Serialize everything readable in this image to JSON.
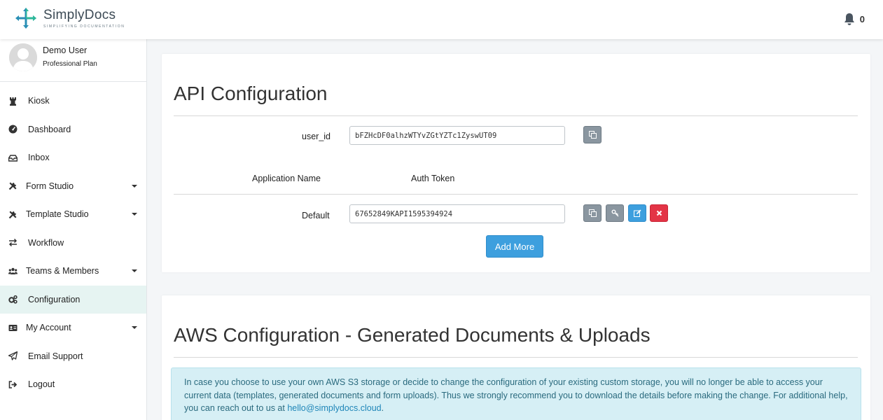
{
  "header": {
    "brand_name": "SimplyDocs",
    "brand_tagline": "SIMPLIFYING DOCUMENTATION",
    "notification_count": "0",
    "logo_colors": [
      "#2eb89a",
      "#2a8fb5"
    ]
  },
  "sidebar": {
    "user_name": "Demo User",
    "user_plan": "Professional Plan",
    "items": [
      {
        "label": "Kiosk",
        "icon": "chess-rook-icon"
      },
      {
        "label": "Dashboard",
        "icon": "tachometer-icon"
      },
      {
        "label": "Inbox",
        "icon": "inbox-icon"
      },
      {
        "label": "Form Studio",
        "icon": "tools-icon",
        "has_caret": true
      },
      {
        "label": "Template Studio",
        "icon": "tools-icon",
        "has_caret": true
      },
      {
        "label": "Workflow",
        "icon": "exchange-icon"
      },
      {
        "label": "Teams & Members",
        "icon": "users-icon",
        "has_caret": true
      },
      {
        "label": "Configuration",
        "icon": "cogs-icon",
        "active": true
      },
      {
        "label": "My Account",
        "icon": "id-card-icon",
        "has_caret": true
      },
      {
        "label": "Email Support",
        "icon": "paper-plane-icon"
      },
      {
        "label": "Logout",
        "icon": "sign-out-icon"
      }
    ],
    "active_color": "#e6f4f2"
  },
  "api_config": {
    "title": "API Configuration",
    "user_id_label": "user_id",
    "user_id_value": "bFZHcDF0alhzWTYvZGtYZTc1ZyswUT09",
    "col_app_name": "Application Name",
    "col_auth_token": "Auth Token",
    "rows": [
      {
        "app_name": "Default",
        "token": "67652849KAPI1595394924"
      }
    ],
    "add_more_label": "Add More"
  },
  "aws_config": {
    "title": "AWS Configuration - Generated Documents & Uploads",
    "notice_text": "In case you choose to use your own AWS S3 storage or decide to change the configuration of your existing custom storage, you will no longer be able to access your current data (templates, generated documents and form uploads). Thus we strongly recommend you to download the details before making the change. For additional help, you can reach out to us at ",
    "notice_email": "hello@simplydocs.cloud",
    "notice_end": "."
  },
  "colors": {
    "primary": "#3d9fde",
    "danger": "#e33446",
    "secondary": "#8a96a0",
    "info_bg": "#d6eff5"
  }
}
